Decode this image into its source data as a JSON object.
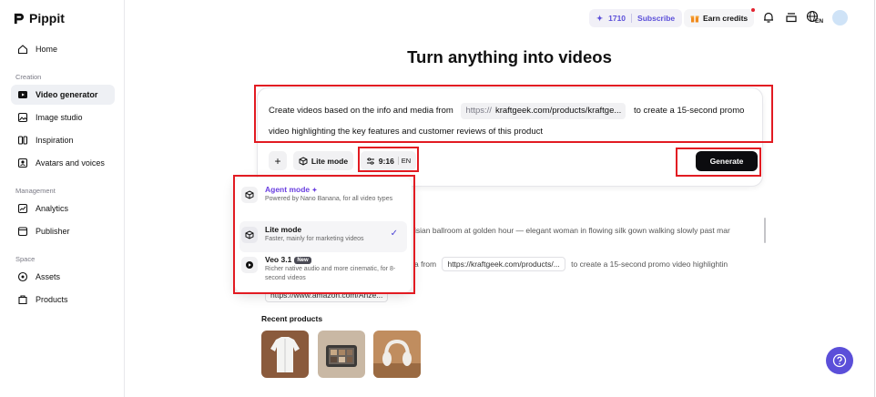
{
  "app": {
    "name": "Pippit"
  },
  "sidebar": {
    "home": "Home",
    "sections": {
      "creation": "Creation",
      "management": "Management",
      "space": "Space"
    },
    "items": [
      {
        "label": "Video generator"
      },
      {
        "label": "Image studio"
      },
      {
        "label": "Inspiration"
      },
      {
        "label": "Avatars and voices"
      },
      {
        "label": "Analytics"
      },
      {
        "label": "Publisher"
      },
      {
        "label": "Assets"
      },
      {
        "label": "Products"
      }
    ]
  },
  "topbar": {
    "credits": "1710",
    "subscribe": "Subscribe",
    "earn_credits": "Earn credits",
    "lang": "EN"
  },
  "main": {
    "title": "Turn anything into videos"
  },
  "prompt": {
    "before": "Create videos based on the info and media from",
    "url_proto": "https://",
    "url": "kraftgeek.com/products/kraftge...",
    "after": "to create a 15-second promo video highlighting the key features and customer reviews of this product"
  },
  "controls": {
    "mode": "Lite mode",
    "ratio": "9:16",
    "lang": "EN",
    "generate": "Generate"
  },
  "mode_menu": [
    {
      "title": "Agent mode",
      "desc": "Powered by Nano Banana, for all video types",
      "selected": false
    },
    {
      "title": "Lite mode",
      "desc": "Faster, mainly for marketing videos",
      "selected": true
    },
    {
      "title": "Veo 3.1",
      "badge": "New",
      "desc": "Richer native audio and more cinematic, for 8-second videos",
      "selected": false
    }
  ],
  "background_examples": {
    "row1": "isian ballroom at golden hour — elegant woman in flowing silk gown walking slowly past mar",
    "row2_prefix": "a from",
    "row2_chip": "https://kraftgeek.com/products/...",
    "row2_suffix": "to create a 15-second promo video highlightin",
    "row3_chip": "https://www.amazon.com/Anze..."
  },
  "recent": {
    "title": "Recent products"
  },
  "colors": {
    "accent": "#5b4fd9",
    "annotation_red": "#e21b22"
  }
}
